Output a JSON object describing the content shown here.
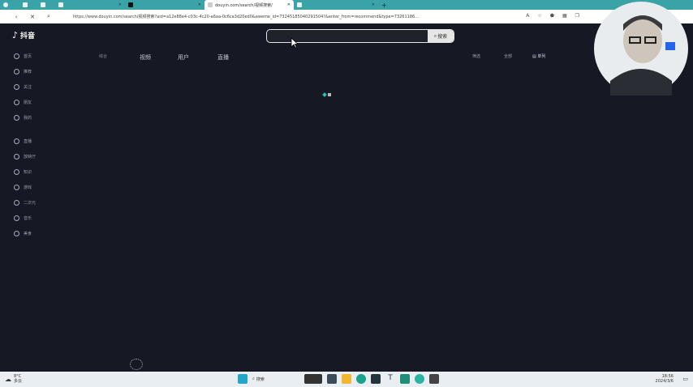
{
  "browser": {
    "tabs": [
      {
        "title": "",
        "active": false
      },
      {
        "title": "",
        "active": false
      },
      {
        "title": "",
        "active": false
      },
      {
        "title": "",
        "active": false
      },
      {
        "title": "douyin.com/search/视频搜索/",
        "active": true
      },
      {
        "title": "",
        "active": false
      }
    ],
    "url": "https://www.douyin.com/search/视频搜索?aid=a12e88e4-c03c-4c20-a6aa-0c6ca3d20ed0&aweme_id=73245185040291504?&enter_from=recommend&type=73261186..."
  },
  "header": {
    "logo_text": "抖音",
    "search_placeholder": "",
    "search_button": "搜索"
  },
  "sidebar": {
    "items": [
      {
        "label": "首页",
        "icon": "home-icon"
      },
      {
        "label": "推荐",
        "icon": "recommend-icon"
      },
      {
        "label": "关注",
        "icon": "follow-icon"
      },
      {
        "label": "朋友",
        "icon": "friends-icon"
      },
      {
        "label": "我的",
        "icon": "profile-icon"
      },
      {
        "label": "直播",
        "icon": "live-icon"
      },
      {
        "label": "放映厅",
        "icon": "cinema-icon"
      },
      {
        "label": "知识",
        "icon": "knowledge-icon"
      },
      {
        "label": "游戏",
        "icon": "game-icon"
      },
      {
        "label": "二次元",
        "icon": "anime-icon"
      },
      {
        "label": "音乐",
        "icon": "music-icon"
      },
      {
        "label": "美食",
        "icon": "food-icon"
      }
    ]
  },
  "content_tabs": [
    "综合",
    "视频",
    "用户",
    "直播"
  ],
  "filters": {
    "left": "筛选",
    "right": "全部",
    "mode": "单列"
  },
  "taskbar": {
    "weather_temp": "8°C",
    "weather_desc": "多云",
    "search_label": "搜索",
    "time": "18:56",
    "date": "2024/3/6"
  },
  "colors": {
    "accent": "#25c2b4",
    "bg": "#161823",
    "tabbar": "#3aa3a8"
  }
}
